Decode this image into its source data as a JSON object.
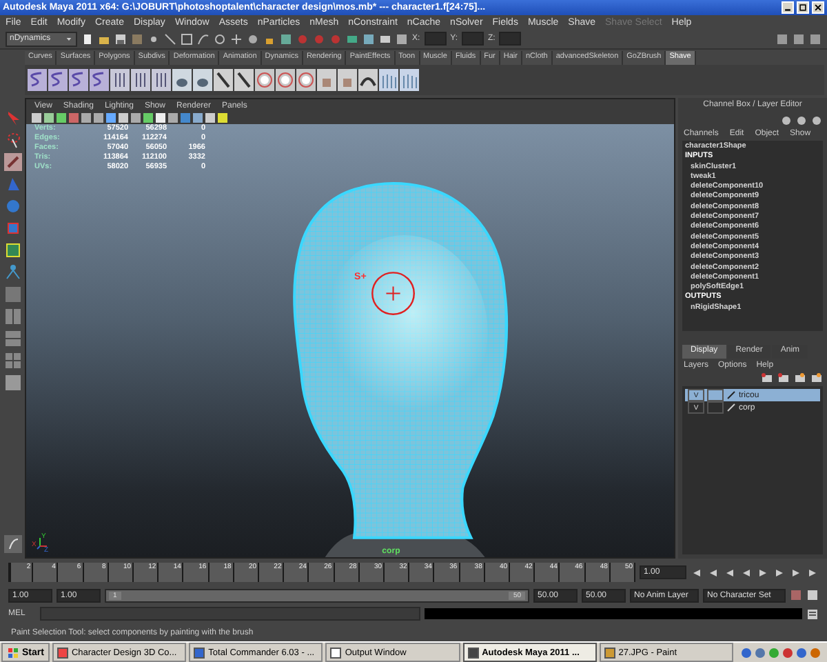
{
  "window": {
    "title": "Autodesk Maya 2011 x64: G:\\JOBURT\\photoshoptalent\\character design\\mos.mb*  ---  character1.f[24:75]..."
  },
  "menu_bar": [
    {
      "label": "File",
      "disabled": false
    },
    {
      "label": "Edit",
      "disabled": false
    },
    {
      "label": "Modify",
      "disabled": false
    },
    {
      "label": "Create",
      "disabled": false
    },
    {
      "label": "Display",
      "disabled": false
    },
    {
      "label": "Window",
      "disabled": false
    },
    {
      "label": "Assets",
      "disabled": false
    },
    {
      "label": "nParticles",
      "disabled": false
    },
    {
      "label": "nMesh",
      "disabled": false
    },
    {
      "label": "nConstraint",
      "disabled": false
    },
    {
      "label": "nCache",
      "disabled": false
    },
    {
      "label": "nSolver",
      "disabled": false
    },
    {
      "label": "Fields",
      "disabled": false
    },
    {
      "label": "Muscle",
      "disabled": false
    },
    {
      "label": "Shave",
      "disabled": false
    },
    {
      "label": "Shave Select",
      "disabled": true
    },
    {
      "label": "Help",
      "disabled": false
    }
  ],
  "status_line": {
    "menu_set": "nDynamics",
    "coord_labels": [
      "X:",
      "Y:",
      "Z:"
    ]
  },
  "shelf_tabs": [
    {
      "label": "Curves",
      "selected": false
    },
    {
      "label": "Surfaces",
      "selected": false
    },
    {
      "label": "Polygons",
      "selected": false
    },
    {
      "label": "Subdivs",
      "selected": false
    },
    {
      "label": "Deformation",
      "selected": false
    },
    {
      "label": "Animation",
      "selected": false
    },
    {
      "label": "Dynamics",
      "selected": false
    },
    {
      "label": "Rendering",
      "selected": false
    },
    {
      "label": "PaintEffects",
      "selected": false
    },
    {
      "label": "Toon",
      "selected": false
    },
    {
      "label": "Muscle",
      "selected": false
    },
    {
      "label": "Fluids",
      "selected": false
    },
    {
      "label": "Fur",
      "selected": false
    },
    {
      "label": "Hair",
      "selected": false
    },
    {
      "label": "nCloth",
      "selected": false
    },
    {
      "label": "advancedSkeleton",
      "selected": false
    },
    {
      "label": "GoZBrush",
      "selected": false
    },
    {
      "label": "Shave",
      "selected": true
    }
  ],
  "viewport": {
    "menu": [
      "View",
      "Shading",
      "Lighting",
      "Show",
      "Renderer",
      "Panels"
    ],
    "hud": [
      {
        "label": "Verts:",
        "values": [
          "57520",
          "56298",
          "0"
        ]
      },
      {
        "label": "Edges:",
        "values": [
          "114164",
          "112274",
          "0"
        ]
      },
      {
        "label": "Faces:",
        "values": [
          "57040",
          "56050",
          "1966"
        ]
      },
      {
        "label": "Tris:",
        "values": [
          "113864",
          "112100",
          "3332"
        ]
      },
      {
        "label": "UVs:",
        "values": [
          "58020",
          "56935",
          "0"
        ]
      }
    ],
    "manipulator_label": "S+",
    "object_label": "corp",
    "axis_labels": [
      "Y",
      "X",
      "Z"
    ]
  },
  "channel_box": {
    "title": "Channel Box / Layer Editor",
    "menu": [
      "Channels",
      "Edit",
      "Object",
      "Show"
    ],
    "items": [
      {
        "kind": "node",
        "text": "character1Shape"
      },
      {
        "kind": "header",
        "text": "INPUTS",
        "children": [
          {
            "kind": "node",
            "text": "skinCluster1"
          },
          {
            "kind": "node",
            "text": "tweak1"
          },
          {
            "kind": "node",
            "text": "deleteComponent10"
          },
          {
            "kind": "node",
            "text": "deleteComponent9"
          },
          {
            "kind": "node",
            "text": "deleteComponent8"
          },
          {
            "kind": "node",
            "text": "deleteComponent7"
          },
          {
            "kind": "node",
            "text": "deleteComponent6"
          },
          {
            "kind": "node",
            "text": "deleteComponent5"
          },
          {
            "kind": "node",
            "text": "deleteComponent4"
          },
          {
            "kind": "node",
            "text": "deleteComponent3"
          },
          {
            "kind": "node",
            "text": "deleteComponent2"
          },
          {
            "kind": "node",
            "text": "deleteComponent1"
          },
          {
            "kind": "node",
            "text": "polySoftEdge1"
          }
        ]
      },
      {
        "kind": "header",
        "text": "OUTPUTS",
        "children": [
          {
            "kind": "node",
            "text": "nRigidShape1"
          }
        ]
      }
    ]
  },
  "layer_editor": {
    "tabs": [
      {
        "label": "Display",
        "selected": true
      },
      {
        "label": "Render",
        "selected": false
      },
      {
        "label": "Anim",
        "selected": false
      }
    ],
    "menu": [
      "Layers",
      "Options",
      "Help"
    ],
    "layers": [
      {
        "visibility": "V",
        "name": "tricou",
        "selected": true
      },
      {
        "visibility": "V",
        "name": "corp",
        "selected": false
      }
    ]
  },
  "time_slider": {
    "frame_labels": [
      "2",
      "4",
      "6",
      "8",
      "10",
      "12",
      "14",
      "16",
      "18",
      "20",
      "22",
      "24",
      "26",
      "28",
      "30",
      "32",
      "34",
      "36",
      "38",
      "40",
      "42",
      "44",
      "46",
      "48",
      "50"
    ],
    "current_frame": "1.00",
    "level": 0
  },
  "range_slider": {
    "start": "1.00",
    "playback_start": "1.00",
    "handle_start": "1",
    "handle_end": "50",
    "level": 1,
    "playback_end": "50.00",
    "end": "50.00",
    "anim_layer": "No Anim Layer",
    "character_set": "No Character Set"
  },
  "command_line": {
    "language": "MEL"
  },
  "help_line": "Paint Selection Tool: select components by painting with the brush",
  "taskbar": {
    "start": "Start",
    "tasks": [
      {
        "label": "Character Design 3D Co...",
        "selected": false
      },
      {
        "label": "Total Commander 6.03 - ...",
        "selected": false
      },
      {
        "label": "Output Window",
        "selected": false
      },
      {
        "label": "Autodesk Maya 2011 ...",
        "selected": true
      },
      {
        "label": "27.JPG - Paint",
        "selected": false
      }
    ]
  }
}
